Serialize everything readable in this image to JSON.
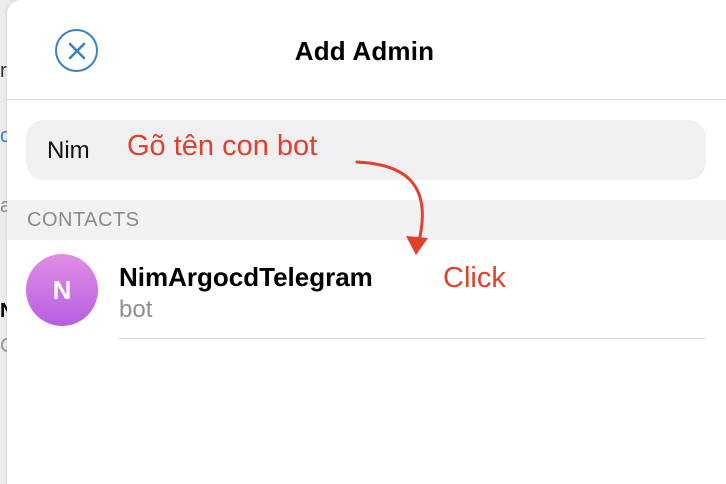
{
  "header": {
    "title": "Add Admin",
    "close_icon": "close-circle-icon"
  },
  "search": {
    "value": "Nim"
  },
  "section": {
    "label": "CONTACTS"
  },
  "contacts": [
    {
      "initial": "N",
      "name": "NimArgocdTelegram",
      "subtitle": "bot"
    }
  ],
  "annotations": {
    "type_hint": "Gõ tên con bot",
    "click_hint": "Click",
    "color": "#e0412b"
  },
  "colors": {
    "accent": "#3a82c4",
    "avatar_gradient": [
      "#e08ee6",
      "#b65fe0"
    ]
  }
}
